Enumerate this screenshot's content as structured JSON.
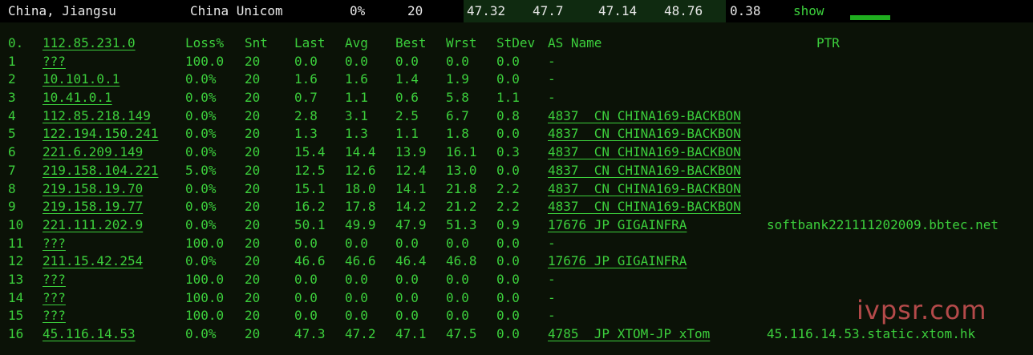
{
  "topbar": {
    "location": "China, Jiangsu",
    "isp": "China Unicom",
    "loss": "0%",
    "sent": "20",
    "v1": "47.32",
    "v2": "47.7",
    "v3": "47.14",
    "v4": "48.76",
    "v5": "0.38",
    "show": "show"
  },
  "header": {
    "idx": "0.",
    "ip": "112.85.231.0",
    "loss": "Loss%",
    "snt": "Snt",
    "last": "Last",
    "avg": "Avg",
    "best": "Best",
    "wrst": "Wrst",
    "stdev": "StDev",
    "as": "AS Name",
    "ptr": "PTR"
  },
  "rows": [
    {
      "idx": "1",
      "ip": "???",
      "loss": "100.0",
      "snt": "20",
      "last": "0.0",
      "avg": "0.0",
      "best": "0.0",
      "wrst": "0.0",
      "stdev": "0.0",
      "as": "-",
      "ptr": ""
    },
    {
      "idx": "2",
      "ip": "10.101.0.1",
      "loss": "0.0%",
      "snt": "20",
      "last": "1.6",
      "avg": "1.6",
      "best": "1.4",
      "wrst": "1.9",
      "stdev": "0.0",
      "as": "-",
      "ptr": ""
    },
    {
      "idx": "3",
      "ip": "10.41.0.1",
      "loss": "0.0%",
      "snt": "20",
      "last": "0.7",
      "avg": "1.1",
      "best": "0.6",
      "wrst": "5.8",
      "stdev": "1.1",
      "as": "-",
      "ptr": ""
    },
    {
      "idx": "4",
      "ip": "112.85.218.149",
      "loss": "0.0%",
      "snt": "20",
      "last": "2.8",
      "avg": "3.1",
      "best": "2.5",
      "wrst": "6.7",
      "stdev": "0.8",
      "as": "4837  CN CHINA169-BACKBON",
      "ptr": ""
    },
    {
      "idx": "5",
      "ip": "122.194.150.241",
      "loss": "0.0%",
      "snt": "20",
      "last": "1.3",
      "avg": "1.3",
      "best": "1.1",
      "wrst": "1.8",
      "stdev": "0.0",
      "as": "4837  CN CHINA169-BACKBON",
      "ptr": ""
    },
    {
      "idx": "6",
      "ip": "221.6.209.149",
      "loss": "0.0%",
      "snt": "20",
      "last": "15.4",
      "avg": "14.4",
      "best": "13.9",
      "wrst": "16.1",
      "stdev": "0.3",
      "as": "4837  CN CHINA169-BACKBON",
      "ptr": ""
    },
    {
      "idx": "7",
      "ip": "219.158.104.221",
      "loss": "5.0%",
      "snt": "20",
      "last": "12.5",
      "avg": "12.6",
      "best": "12.4",
      "wrst": "13.0",
      "stdev": "0.0",
      "as": "4837  CN CHINA169-BACKBON",
      "ptr": ""
    },
    {
      "idx": "8",
      "ip": "219.158.19.70",
      "loss": "0.0%",
      "snt": "20",
      "last": "15.1",
      "avg": "18.0",
      "best": "14.1",
      "wrst": "21.8",
      "stdev": "2.2",
      "as": "4837  CN CHINA169-BACKBON",
      "ptr": ""
    },
    {
      "idx": "9",
      "ip": "219.158.19.77",
      "loss": "0.0%",
      "snt": "20",
      "last": "16.2",
      "avg": "17.8",
      "best": "14.2",
      "wrst": "21.2",
      "stdev": "2.2",
      "as": "4837  CN CHINA169-BACKBON",
      "ptr": ""
    },
    {
      "idx": "10",
      "ip": "221.111.202.9",
      "loss": "0.0%",
      "snt": "20",
      "last": "50.1",
      "avg": "49.9",
      "best": "47.9",
      "wrst": "51.3",
      "stdev": "0.9",
      "as": "17676 JP GIGAINFRA",
      "ptr": "softbank221111202009.bbtec.net"
    },
    {
      "idx": "11",
      "ip": "???",
      "loss": "100.0",
      "snt": "20",
      "last": "0.0",
      "avg": "0.0",
      "best": "0.0",
      "wrst": "0.0",
      "stdev": "0.0",
      "as": "-",
      "ptr": ""
    },
    {
      "idx": "12",
      "ip": "211.15.42.254",
      "loss": "0.0%",
      "snt": "20",
      "last": "46.6",
      "avg": "46.6",
      "best": "46.4",
      "wrst": "46.8",
      "stdev": "0.0",
      "as": "17676 JP GIGAINFRA",
      "ptr": ""
    },
    {
      "idx": "13",
      "ip": "???",
      "loss": "100.0",
      "snt": "20",
      "last": "0.0",
      "avg": "0.0",
      "best": "0.0",
      "wrst": "0.0",
      "stdev": "0.0",
      "as": "-",
      "ptr": ""
    },
    {
      "idx": "14",
      "ip": "???",
      "loss": "100.0",
      "snt": "20",
      "last": "0.0",
      "avg": "0.0",
      "best": "0.0",
      "wrst": "0.0",
      "stdev": "0.0",
      "as": "-",
      "ptr": ""
    },
    {
      "idx": "15",
      "ip": "???",
      "loss": "100.0",
      "snt": "20",
      "last": "0.0",
      "avg": "0.0",
      "best": "0.0",
      "wrst": "0.0",
      "stdev": "0.0",
      "as": "-",
      "ptr": ""
    },
    {
      "idx": "16",
      "ip": "45.116.14.53",
      "loss": "0.0%",
      "snt": "20",
      "last": "47.3",
      "avg": "47.2",
      "best": "47.1",
      "wrst": "47.5",
      "stdev": "0.0",
      "as": "4785  JP XTOM-JP xTom",
      "ptr": "45.116.14.53.static.xtom.hk"
    }
  ],
  "watermark": "ivpsr.com"
}
